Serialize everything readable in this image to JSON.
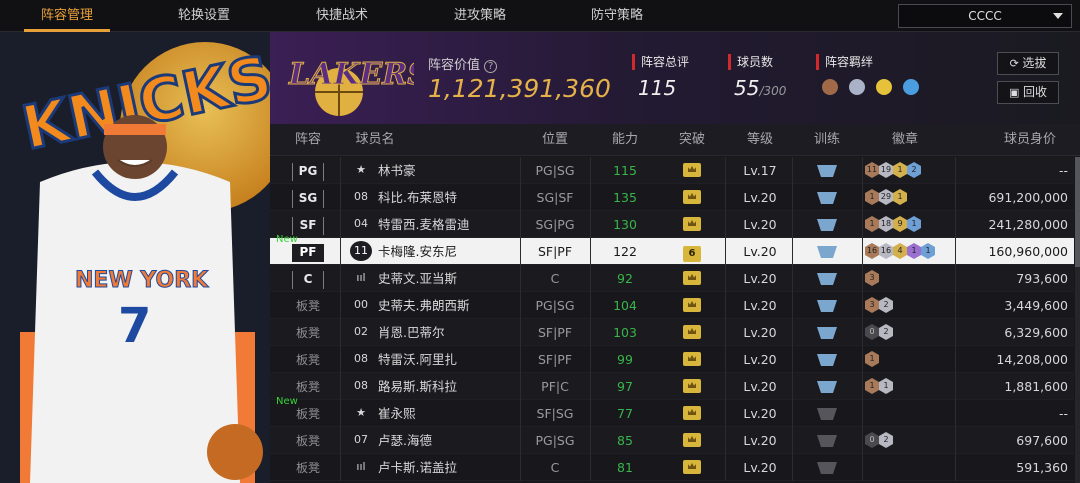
{
  "nav": {
    "tabs": [
      "阵容管理",
      "轮换设置",
      "快捷战术",
      "进攻策略",
      "防守策略"
    ],
    "team": "CCCC"
  },
  "header": {
    "value_label": "阵容价值",
    "value": "1,121,391,360",
    "rating_label": "阵容总评",
    "rating": "115",
    "count_label": "球员数",
    "count": "55",
    "count_max": "/300",
    "chem_label": "阵容羁绊",
    "select_btn": "选拔",
    "recycle_btn": "回收",
    "logo_text": "LAKERS"
  },
  "art": {
    "team_text": "KNICKS",
    "jersey_text": "NEW YORK",
    "jersey_num": "7"
  },
  "columns": [
    "阵容",
    "球员名",
    "位置",
    "能力",
    "突破",
    "等级",
    "训练",
    "徽章",
    "球员身价"
  ],
  "rows": [
    {
      "slot": "PG",
      "bench": false,
      "num": "★",
      "name": "林书豪",
      "pos": "PG|SG",
      "ability": "115",
      "green": true,
      "breakthrough": "",
      "level": "Lv.17",
      "train": "blue",
      "badges": [
        [
          "b",
          "11"
        ],
        [
          "s",
          "19"
        ],
        [
          "g",
          "1"
        ],
        [
          "bl",
          "2"
        ]
      ],
      "value": "--",
      "new": false
    },
    {
      "slot": "SG",
      "bench": false,
      "num": "08",
      "name": "科比.布莱恩特",
      "pos": "SG|SF",
      "ability": "135",
      "green": true,
      "breakthrough": "",
      "level": "Lv.20",
      "train": "blue",
      "badges": [
        [
          "b",
          "1"
        ],
        [
          "s",
          "29"
        ],
        [
          "g",
          "1"
        ]
      ],
      "value": "691,200,000",
      "new": false
    },
    {
      "slot": "SF",
      "bench": false,
      "num": "04",
      "name": "特雷西.麦格雷迪",
      "pos": "SG|PG",
      "ability": "130",
      "green": true,
      "breakthrough": "",
      "level": "Lv.20",
      "train": "blue",
      "badges": [
        [
          "b",
          "1"
        ],
        [
          "s",
          "18"
        ],
        [
          "g",
          "9"
        ],
        [
          "bl",
          "1"
        ]
      ],
      "value": "241,280,000",
      "new": false
    },
    {
      "slot": "PF",
      "bench": false,
      "num": "11",
      "name": "卡梅隆.安东尼",
      "pos": "SF|PF",
      "ability": "122",
      "green": false,
      "breakthrough": "6",
      "level": "Lv.20",
      "train": "blue",
      "badges": [
        [
          "b",
          "16"
        ],
        [
          "s",
          "16"
        ],
        [
          "g",
          "4"
        ],
        [
          "p",
          "1"
        ],
        [
          "bl",
          "1"
        ]
      ],
      "value": "160,960,000",
      "new": true,
      "selected": true
    },
    {
      "slot": "C",
      "bench": false,
      "num": "ııl",
      "name": "史蒂文.亚当斯",
      "pos": "C",
      "ability": "92",
      "green": true,
      "breakthrough": "",
      "level": "Lv.20",
      "train": "blue",
      "badges": [
        [
          "b",
          "3"
        ]
      ],
      "value": "793,600",
      "new": false
    },
    {
      "slot": "板凳",
      "bench": true,
      "num": "00",
      "name": "史蒂夫.弗朗西斯",
      "pos": "PG|SG",
      "ability": "104",
      "green": true,
      "breakthrough": "",
      "level": "Lv.20",
      "train": "blue",
      "badges": [
        [
          "b",
          "3"
        ],
        [
          "s",
          "2"
        ]
      ],
      "value": "3,449,600",
      "new": false
    },
    {
      "slot": "板凳",
      "bench": true,
      "num": "02",
      "name": "肖恩.巴蒂尔",
      "pos": "SF|PF",
      "ability": "103",
      "green": true,
      "breakthrough": "",
      "level": "Lv.20",
      "train": "blue",
      "badges": [
        [
          "d",
          "0"
        ],
        [
          "s",
          "2"
        ]
      ],
      "value": "6,329,600",
      "new": false
    },
    {
      "slot": "板凳",
      "bench": true,
      "num": "08",
      "name": "特雷沃.阿里扎",
      "pos": "SF|PF",
      "ability": "99",
      "green": true,
      "breakthrough": "",
      "level": "Lv.20",
      "train": "blue",
      "badges": [
        [
          "b",
          "1"
        ]
      ],
      "value": "14,208,000",
      "new": false
    },
    {
      "slot": "板凳",
      "bench": true,
      "num": "08",
      "name": "路易斯.斯科拉",
      "pos": "PF|C",
      "ability": "97",
      "green": true,
      "breakthrough": "",
      "level": "Lv.20",
      "train": "blue",
      "badges": [
        [
          "b",
          "1"
        ],
        [
          "s",
          "1"
        ]
      ],
      "value": "1,881,600",
      "new": false
    },
    {
      "slot": "板凳",
      "bench": true,
      "num": "★",
      "name": "崔永熙",
      "pos": "SF|SG",
      "ability": "77",
      "green": true,
      "breakthrough": "",
      "level": "Lv.20",
      "train": "gray",
      "badges": [],
      "value": "--",
      "new": true
    },
    {
      "slot": "板凳",
      "bench": true,
      "num": "07",
      "name": "卢瑟.海德",
      "pos": "PG|SG",
      "ability": "85",
      "green": true,
      "breakthrough": "",
      "level": "Lv.20",
      "train": "gray",
      "badges": [
        [
          "d",
          "0"
        ],
        [
          "s",
          "2"
        ]
      ],
      "value": "697,600",
      "new": false
    },
    {
      "slot": "板凳",
      "bench": true,
      "num": "ııl",
      "name": "卢卡斯.诺盖拉",
      "pos": "C",
      "ability": "81",
      "green": true,
      "breakthrough": "",
      "level": "Lv.20",
      "train": "gray",
      "badges": [],
      "value": "591,360",
      "new": false
    }
  ],
  "new_label": "New",
  "colors": {
    "accent": "#e8a13a",
    "lakers_purple": "#3b1f55",
    "gold": "#e0b040",
    "ability_green": "#39b54a"
  }
}
